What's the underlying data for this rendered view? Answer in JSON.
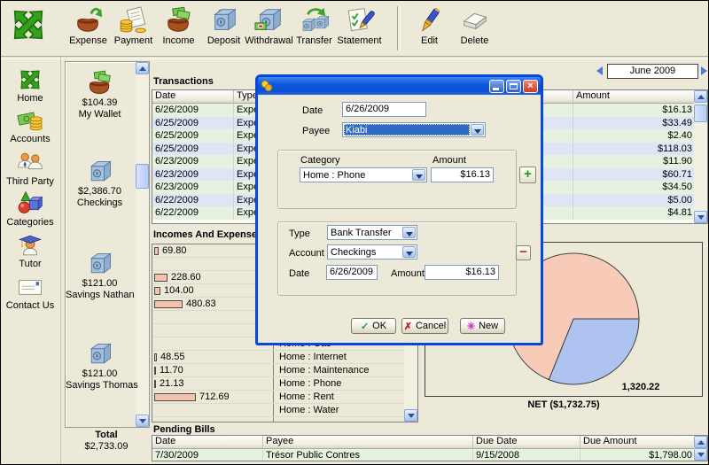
{
  "toolbar": {
    "main_items": [
      {
        "icon": "expense-icon",
        "label": "Expense"
      },
      {
        "icon": "payment-icon",
        "label": "Payment"
      },
      {
        "icon": "income-icon",
        "label": "Income"
      },
      {
        "icon": "deposit-icon",
        "label": "Deposit"
      },
      {
        "icon": "withdrawal-icon",
        "label": "Withdrawal"
      },
      {
        "icon": "transfer-icon",
        "label": "Transfer"
      },
      {
        "icon": "statement-icon",
        "label": "Statement"
      }
    ],
    "edit_items": [
      {
        "icon": "edit-icon",
        "label": "Edit"
      },
      {
        "icon": "delete-icon",
        "label": "Delete"
      }
    ]
  },
  "sidebar": {
    "items": [
      {
        "icon": "home-icon",
        "label": "Home"
      },
      {
        "icon": "accounts-icon",
        "label": "Accounts"
      },
      {
        "icon": "third-party-icon",
        "label": "Third Party"
      },
      {
        "icon": "categories-icon",
        "label": "Categories"
      },
      {
        "icon": "tutor-icon",
        "label": "Tutor"
      },
      {
        "icon": "contact-icon",
        "label": "Contact Us"
      }
    ]
  },
  "accounts_panel": {
    "items": [
      {
        "icon": "wallet-icon",
        "amount": "$104.39",
        "name": "My Wallet"
      },
      {
        "icon": "safe-icon",
        "amount": "$2,386.70",
        "name": "Checkings"
      },
      {
        "icon": "safe-icon",
        "amount": "$121.00",
        "name": "Savings Nathan"
      },
      {
        "icon": "safe-icon",
        "amount": "$121.00",
        "name": "Savings Thomas"
      }
    ],
    "total_label": "Total",
    "total_value": "$2,733.09"
  },
  "date_navigator": {
    "value": "June 2009"
  },
  "transactions": {
    "title": "Transactions",
    "columns": [
      "Date",
      "Type",
      "Amount"
    ],
    "rows": [
      {
        "date": "6/26/2009",
        "type": "Expense",
        "amount": "$16.13"
      },
      {
        "date": "6/25/2009",
        "type": "Expense",
        "amount": "$33.49"
      },
      {
        "date": "6/25/2009",
        "type": "Expense",
        "amount": "$2.40"
      },
      {
        "date": "6/25/2009",
        "type": "Expense",
        "amount": "$118.03"
      },
      {
        "date": "6/23/2009",
        "type": "Expense",
        "amount": "$11.90"
      },
      {
        "date": "6/23/2009",
        "type": "Expense",
        "amount": "$60.71"
      },
      {
        "date": "6/23/2009",
        "type": "Expense",
        "amount": "$34.50"
      },
      {
        "date": "6/22/2009",
        "type": "Expense",
        "amount": "$5.00"
      },
      {
        "date": "6/22/2009",
        "type": "Expense",
        "amount": "$4.81"
      }
    ]
  },
  "incomes_expenses": {
    "title": "Incomes And Expenses",
    "rows": [
      {
        "value": 69.8,
        "label": "69.80",
        "category": ""
      },
      {
        "value": null,
        "label": "",
        "category": ""
      },
      {
        "value": 228.6,
        "label": "228.60",
        "category": ""
      },
      {
        "value": 104.0,
        "label": "104.00",
        "category": ""
      },
      {
        "value": 480.83,
        "label": "480.83",
        "category": ""
      },
      {
        "value": null,
        "label": "",
        "category": ""
      },
      {
        "value": null,
        "label": "",
        "category": ""
      },
      {
        "value": null,
        "label": "",
        "category": "Home : Gas"
      },
      {
        "value": 48.55,
        "label": "48.55",
        "category": "Home : Internet"
      },
      {
        "value": 11.7,
        "label": "11.70",
        "category": "Home : Maintenance"
      },
      {
        "value": 21.13,
        "label": "21.13",
        "category": "Home : Phone"
      },
      {
        "value": 712.69,
        "label": "712.69",
        "category": "Home : Rent"
      },
      {
        "value": null,
        "label": "",
        "category": "Home : Water"
      },
      {
        "value": null,
        "label": "",
        "category": ""
      }
    ]
  },
  "summary_chart": {
    "value_label": "1,320.22",
    "net_label": "NET ($1,732.75)"
  },
  "chart_data": [
    {
      "type": "bar",
      "orientation": "horizontal",
      "title": "Incomes And Expenses",
      "values": [
        69.8,
        228.6,
        104.0,
        480.83,
        48.55,
        11.7,
        21.13,
        712.69
      ],
      "visible_categories": [
        "Home : Gas",
        "Home : Internet",
        "Home : Maintenance",
        "Home : Phone",
        "Home : Rent",
        "Home : Water"
      ]
    },
    {
      "type": "pie",
      "footer": "NET ($1,732.75)",
      "slices": [
        {
          "name": "income",
          "color": "#AEC3F0",
          "sweep_deg": 112,
          "label": "1,320.22"
        },
        {
          "name": "expense",
          "color": "#F7CBB8",
          "sweep_deg": 248,
          "label": ""
        }
      ]
    }
  ],
  "pending_bills": {
    "title": "Pending Bills",
    "columns": [
      "Date",
      "Payee",
      "Due Date",
      "Due Amount"
    ],
    "rows": [
      {
        "date": "7/30/2009",
        "payee": "Trésor Public Contres",
        "due_date": "9/15/2008",
        "due_amount": "$1,798.00"
      }
    ]
  },
  "dialog": {
    "date_label": "Date",
    "date_value": "6/26/2009",
    "payee_label": "Payee",
    "payee_value": "Kiabi",
    "category_label": "Category",
    "category_value": "Home : Phone",
    "amount_label": "Amount",
    "amount_value": "$16.13",
    "add_button": "+",
    "type_label": "Type",
    "type_value": "Bank Transfer",
    "account_label": "Account",
    "account_value": "Checkings",
    "date2_label": "Date",
    "date2_value": "6/26/2009",
    "amount2_label": "Amount",
    "amount2_value": "$16.13",
    "remove_button": "−",
    "ok_label": "OK",
    "cancel_label": "Cancel",
    "new_label": "New",
    "close_glyph": "×"
  }
}
